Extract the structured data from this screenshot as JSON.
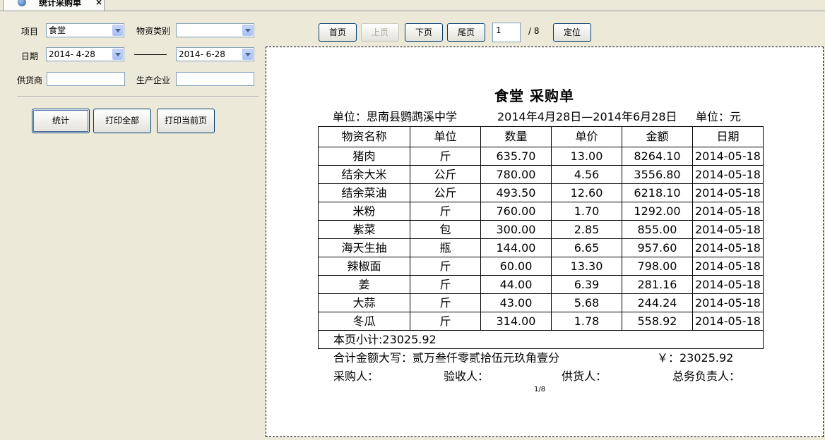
{
  "tab": {
    "title": "统计采购单",
    "close": "×"
  },
  "filters": {
    "project_label": "项目",
    "project_value": "食堂",
    "category_label": "物资类别",
    "category_value": "",
    "date_label": "日期",
    "date_from": "2014- 4-28",
    "date_to": "2014- 6-28",
    "supplier_label": "供货商",
    "supplier_value": "",
    "manufacturer_label": "生产企业",
    "manufacturer_value": ""
  },
  "actions": {
    "stat": "统计",
    "print_all": "打印全部",
    "print_current": "打印当前页"
  },
  "pager": {
    "first": "首页",
    "prev": "上页",
    "next": "下页",
    "last": "尾页",
    "current": "1",
    "total": "/ 8",
    "locate": "定位"
  },
  "report": {
    "title": "食堂 采购单",
    "unit_org": "单位：思南县鹦鹉溪中学",
    "period": "2014年4月28日—2014年6月28日",
    "currency_unit": "单位：元",
    "headers": [
      "物资名称",
      "单位",
      "数量",
      "单价",
      "金额",
      "日期"
    ],
    "rows": [
      [
        "猪肉",
        "斤",
        "635.70",
        "13.00",
        "8264.10",
        "2014-05-18"
      ],
      [
        "结余大米",
        "公斤",
        "780.00",
        "4.56",
        "3556.80",
        "2014-05-18"
      ],
      [
        "结余菜油",
        "公斤",
        "493.50",
        "12.60",
        "6218.10",
        "2014-05-18"
      ],
      [
        "米粉",
        "斤",
        "760.00",
        "1.70",
        "1292.00",
        "2014-05-18"
      ],
      [
        "紫菜",
        "包",
        "300.00",
        "2.85",
        "855.00",
        "2014-05-18"
      ],
      [
        "海天生抽",
        "瓶",
        "144.00",
        "6.65",
        "957.60",
        "2014-05-18"
      ],
      [
        "辣椒面",
        "斤",
        "60.00",
        "13.30",
        "798.00",
        "2014-05-18"
      ],
      [
        "姜",
        "斤",
        "44.00",
        "6.39",
        "281.16",
        "2014-05-18"
      ],
      [
        "大蒜",
        "斤",
        "43.00",
        "5.68",
        "244.24",
        "2014-05-18"
      ],
      [
        "冬瓜",
        "斤",
        "314.00",
        "1.78",
        "558.92",
        "2014-05-18"
      ]
    ],
    "subtotal": "本页小计:23025.92",
    "total_words": "合计金额大写：贰万叁仟零贰拾伍元玖角壹分",
    "total_number": "￥：23025.92",
    "signer_buyer": "采购人：",
    "signer_receiver": "验收人：",
    "signer_supplier": "供货人：",
    "signer_manager": "总务负责人：",
    "page_number": "1/8"
  }
}
